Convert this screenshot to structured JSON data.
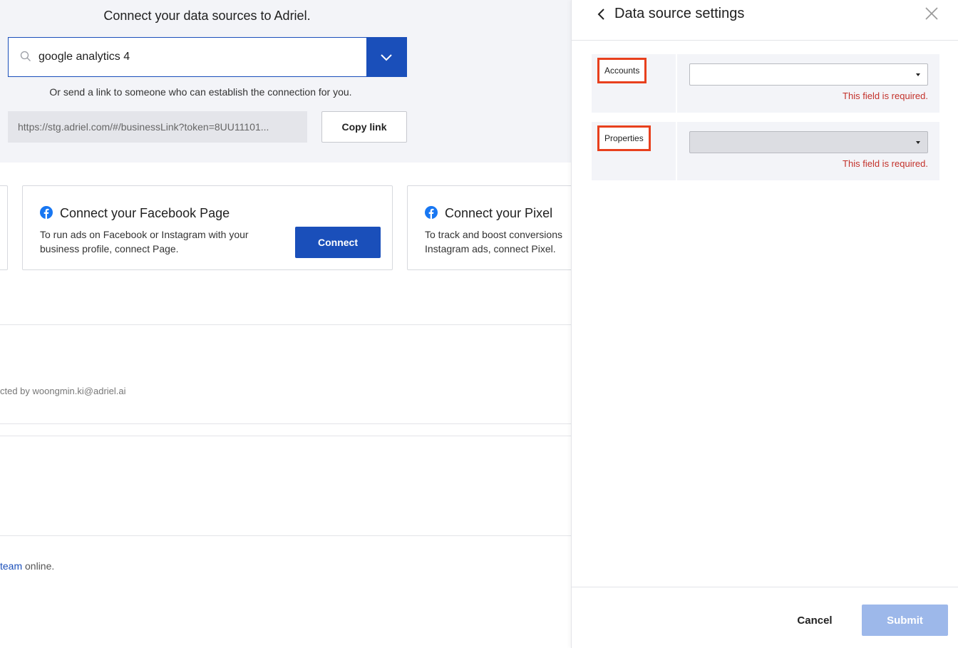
{
  "hero": {
    "title": "Connect your data sources to Adriel.",
    "search_value": "google analytics 4",
    "share_text": "Or send a link to someone who can establish the connection for you.",
    "share_link": "https://stg.adriel.com/#/businessLink?token=8UU11101...",
    "copy_label": "Copy link"
  },
  "cards": [
    {
      "title": "Connect your Facebook Page",
      "description": "To run ads on Facebook or Instagram with your business profile, connect Page.",
      "button_label": "Connect",
      "icon": "facebook-icon"
    },
    {
      "title": "Connect your Pixel",
      "description_line1": "To track and boost conversions",
      "description_line2": "Instagram ads, connect Pixel.",
      "icon": "facebook-icon"
    }
  ],
  "main": {
    "connected_by": "cted by woongmin.ki@adriel.ai",
    "online_link": "team",
    "online_suffix": " online."
  },
  "panel": {
    "title": "Data source settings",
    "fields": [
      {
        "label": "Accounts",
        "value": "",
        "error": "This field is required."
      },
      {
        "label": "Properties",
        "value": "",
        "error": "This field is required."
      }
    ],
    "cancel_label": "Cancel",
    "submit_label": "Submit"
  },
  "colors": {
    "brand": "#1a4fba",
    "error": "#c3312a",
    "highlight": "#e8401d",
    "submit_disabled": "#9db8ea"
  }
}
